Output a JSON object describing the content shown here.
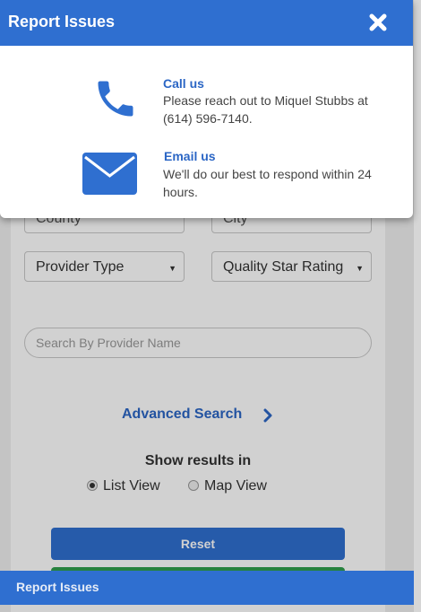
{
  "modal": {
    "title": "Report Issues",
    "close_icon": "close-icon",
    "contacts": [
      {
        "icon": "phone-icon",
        "title": "Call us",
        "text": "Please reach out to Miquel Stubbs at (614) 596-7140."
      },
      {
        "icon": "envelope-icon",
        "title": "Email us",
        "text": "We'll do our best to respond within 24 hours."
      }
    ]
  },
  "form": {
    "county_placeholder": "County",
    "city_placeholder": "City",
    "provider_type": "Provider Type",
    "quality_rating": "Quality Star Rating",
    "search_placeholder": "Search By Provider Name",
    "advanced_search": "Advanced Search",
    "show_results_title": "Show results in",
    "view_options": [
      {
        "label": "List View",
        "selected": true
      },
      {
        "label": "Map View",
        "selected": false
      }
    ],
    "reset_label": "Reset"
  },
  "footer": {
    "label": "Report Issues"
  },
  "colors": {
    "brand_blue": "#2f6fd0",
    "link_blue": "#2b66c5",
    "green": "#2f9e4c"
  }
}
